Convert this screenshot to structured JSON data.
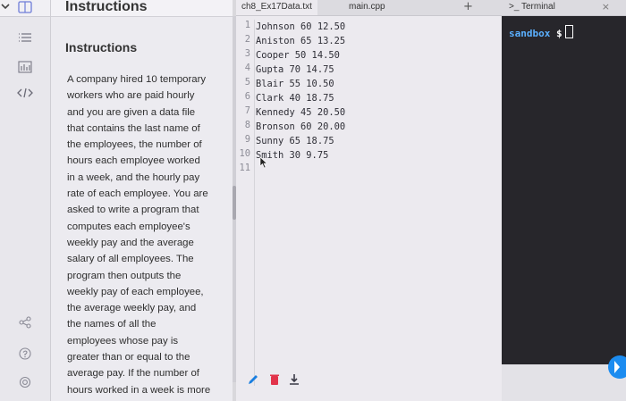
{
  "instructions": {
    "header_title": "Instructions",
    "title": "Instructions",
    "body_lines": [
      "A company hired 10 temporary",
      "workers who are paid hourly",
      "and you are given a data file",
      "that contains the last name of",
      "the employees, the number of",
      "hours each employee worked",
      "in a week, and the hourly pay",
      "rate of each employee. You are",
      "asked to write a program that",
      "computes each employee's",
      "weekly pay and the average",
      "salary of all employees. The",
      "program then outputs the",
      "weekly pay of each employee,",
      "the average weekly pay, and",
      "the names of all the",
      "employees whose pay is",
      "greater than or equal to the",
      "average pay. If the number of",
      "hours worked in a week is more"
    ]
  },
  "editor": {
    "tabs": [
      {
        "label": "ch8_Ex17Data.txt",
        "active": true
      },
      {
        "label": "main.cpp",
        "active": false
      }
    ],
    "add_tab": "+",
    "lines": [
      {
        "num": "1",
        "text": "Johnson 60 12.50"
      },
      {
        "num": "2",
        "text": "Aniston 65 13.25"
      },
      {
        "num": "3",
        "text": "Cooper 50 14.50"
      },
      {
        "num": "4",
        "text": "Gupta 70 14.75"
      },
      {
        "num": "5",
        "text": "Blair 55 10.50"
      },
      {
        "num": "6",
        "text": "Clark 40 18.75"
      },
      {
        "num": "7",
        "text": "Kennedy 45 20.50"
      },
      {
        "num": "8",
        "text": "Bronson 60 20.00"
      },
      {
        "num": "9",
        "text": "Sunny 65 18.75"
      },
      {
        "num": "10",
        "text": "Smith 30 9.75"
      },
      {
        "num": "11",
        "text": ""
      }
    ]
  },
  "terminal": {
    "tab_label": ">_ Terminal",
    "close": "×",
    "host": "sandbox",
    "sign": "$"
  },
  "colors": {
    "accent": "#1c8cf0",
    "pencil": "#1a7fe0",
    "trash": "#e2344b",
    "terminal_bg": "#27262b"
  }
}
